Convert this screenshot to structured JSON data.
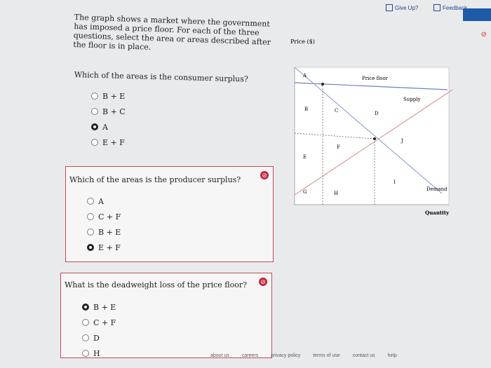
{
  "topbar": {
    "give_up": "Give Up?",
    "feedback": "Feedback"
  },
  "intro": "The graph shows a market where the government has imposed a price floor. For each of the three questions, select the area or areas described after the floor is in place.",
  "questions": [
    {
      "title": "Which of the areas is the consumer surplus?",
      "options": [
        "B + E",
        "B + C",
        "A",
        "E + F"
      ],
      "selected_index": 2
    },
    {
      "title": "Which of the areas is the producer surplus?",
      "options": [
        "A",
        "C + F",
        "B + E",
        "E + F"
      ],
      "selected_index": 3
    },
    {
      "title": "What is the deadweight loss of the price floor?",
      "options": [
        "B + E",
        "C + F",
        "D",
        "H"
      ],
      "selected_index": 0
    }
  ],
  "graph": {
    "y_label": "Price ($)",
    "x_label": "Quantity",
    "line_labels": {
      "price_floor": "Price floor",
      "supply": "Supply",
      "demand": "Demand"
    },
    "areas": [
      "A",
      "B",
      "C",
      "D",
      "E",
      "F",
      "G",
      "H",
      "I",
      "J"
    ]
  },
  "footer": [
    "about us",
    "careers",
    "privacy policy",
    "terms of use",
    "contact us",
    "help"
  ]
}
